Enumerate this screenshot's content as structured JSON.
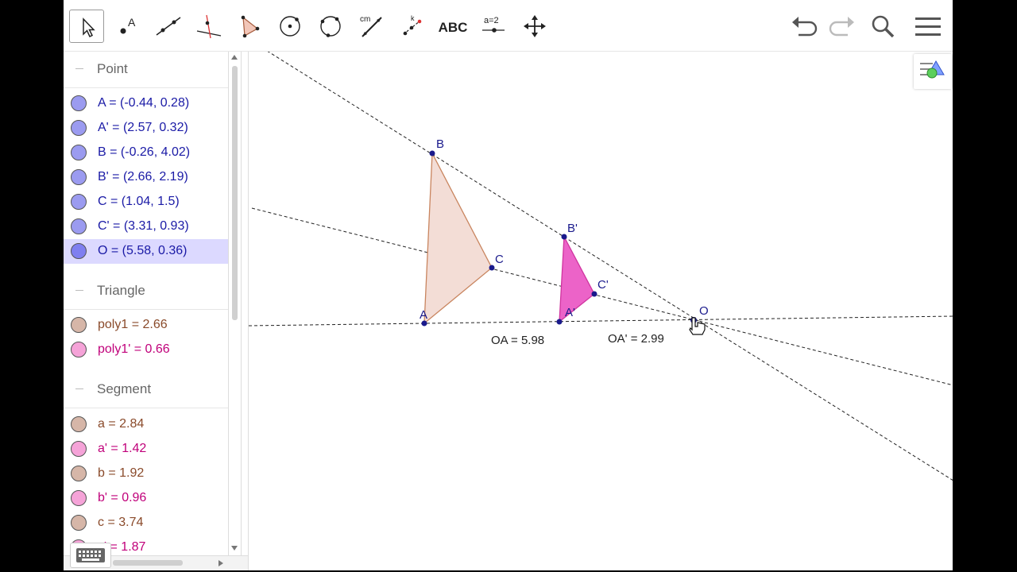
{
  "toolbar": {
    "tools": [
      {
        "name": "move-tool",
        "active": true
      },
      {
        "name": "point-tool",
        "label": "A"
      },
      {
        "name": "line-tool"
      },
      {
        "name": "perpendicular-line-tool"
      },
      {
        "name": "polygon-tool"
      },
      {
        "name": "circle-tool"
      },
      {
        "name": "circle-through-3-points-tool"
      },
      {
        "name": "distance-tool",
        "label": "cm"
      },
      {
        "name": "dilate-tool",
        "label": "k"
      },
      {
        "name": "text-tool",
        "label": "ABC"
      },
      {
        "name": "slider-tool",
        "label": "a=2"
      },
      {
        "name": "move-graphics-view-tool"
      }
    ],
    "icons": {
      "undo": "undo-icon",
      "redo": "redo-icon",
      "search": "search-icon",
      "menu": "hamburger-menu-icon"
    }
  },
  "algebra": {
    "groups": [
      {
        "title": "Point",
        "items": [
          {
            "text": "A = (-0.44, 0.28)",
            "color": "#1a1aa6",
            "fill": "#9b9bf0"
          },
          {
            "text": "A' = (2.57, 0.32)",
            "color": "#1a1aa6",
            "fill": "#9b9bf0"
          },
          {
            "text": "B = (-0.26, 4.02)",
            "color": "#1a1aa6",
            "fill": "#9b9bf0"
          },
          {
            "text": "B' = (2.66, 2.19)",
            "color": "#1a1aa6",
            "fill": "#9b9bf0"
          },
          {
            "text": "C = (1.04, 1.5)",
            "color": "#1a1aa6",
            "fill": "#9b9bf0"
          },
          {
            "text": "C' = (3.31, 0.93)",
            "color": "#1a1aa6",
            "fill": "#9b9bf0"
          },
          {
            "text": "O = (5.58, 0.36)",
            "color": "#1a1aa6",
            "fill": "#7f7ff0",
            "selected": true
          }
        ]
      },
      {
        "title": "Triangle",
        "items": [
          {
            "text": "poly1 = 2.66",
            "color": "#8a4a2a",
            "fill": "#d6b6a8"
          },
          {
            "text": "poly1' = 0.66",
            "color": "#c0007a",
            "fill": "#f5a3d8"
          }
        ]
      },
      {
        "title": "Segment",
        "items": [
          {
            "text": "a = 2.84",
            "color": "#8a4a2a",
            "fill": "#d6b6a8"
          },
          {
            "text": "a' = 1.42",
            "color": "#c0007a",
            "fill": "#f5a3d8"
          },
          {
            "text": "b = 1.92",
            "color": "#8a4a2a",
            "fill": "#d6b6a8"
          },
          {
            "text": "b' = 0.96",
            "color": "#c0007a",
            "fill": "#f5a3d8"
          },
          {
            "text": "c = 3.74",
            "color": "#8a4a2a",
            "fill": "#d6b6a8"
          },
          {
            "text": "c' = 1.87",
            "color": "#c0007a",
            "fill": "#f5a3d8"
          }
        ]
      }
    ]
  },
  "graphics": {
    "points": {
      "A": "A",
      "A_prime": "A'",
      "B": "B",
      "B_prime": "B'",
      "C": "C",
      "C_prime": "C'",
      "O": "O"
    },
    "measures": {
      "oa": "OA = 5.98",
      "oa_prime": "OA' = 2.99"
    },
    "colors": {
      "triangle_fill": "#f3ddd6",
      "triangle_stroke": "#c9855f",
      "image_fill": "#ec63c8",
      "image_stroke": "#d0349f",
      "point": "#1a1a8c"
    }
  }
}
